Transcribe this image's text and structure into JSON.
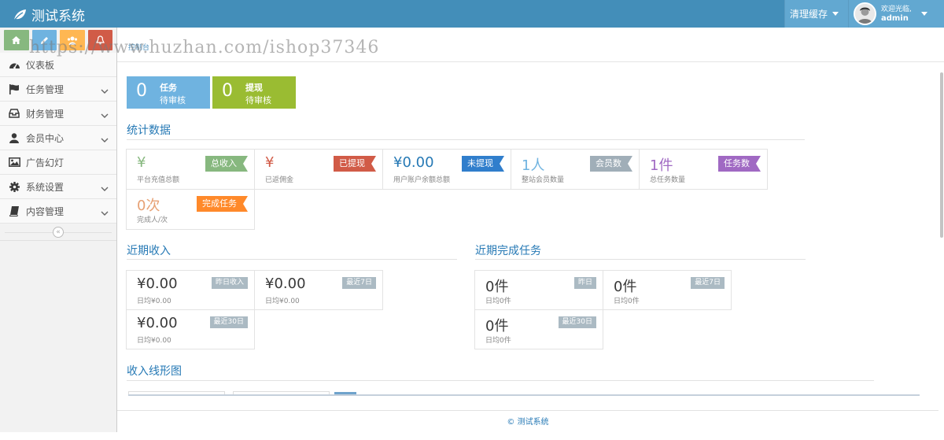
{
  "app": {
    "title": "测试系统"
  },
  "navbar": {
    "clear_cache": "清理缓存",
    "welcome": "欢迎光临,",
    "username": "admin"
  },
  "watermark": "https://www.huzhan.com/ishop37346",
  "breadcrumb": "控制台",
  "sidebar": {
    "items": [
      {
        "label": "仪表板",
        "icon": "dashboard-icon",
        "has_children": false
      },
      {
        "label": "任务管理",
        "icon": "flag-icon",
        "has_children": true
      },
      {
        "label": "财务管理",
        "icon": "inbox-icon",
        "has_children": true
      },
      {
        "label": "会员中心",
        "icon": "user-icon",
        "has_children": true
      },
      {
        "label": "广告幻灯",
        "icon": "picture-icon",
        "has_children": false
      },
      {
        "label": "系统设置",
        "icon": "gear-icon",
        "has_children": true
      },
      {
        "label": "内容管理",
        "icon": "book-icon",
        "has_children": true
      }
    ]
  },
  "pending": [
    {
      "count": "0",
      "title": "任务",
      "subtitle": "待审核",
      "color": "#6fb3e0"
    },
    {
      "count": "0",
      "title": "提现",
      "subtitle": "待审核",
      "color": "#9abc32"
    }
  ],
  "stats": {
    "title": "统计数据",
    "cells": [
      {
        "value": "¥",
        "label": "平台充值总额",
        "tag": "总收入",
        "value_color": "#87b87f",
        "tag_color": "#87b87f"
      },
      {
        "value": "¥",
        "label": "已返佣金",
        "tag": "已提现",
        "value_color": "#d15b47",
        "tag_color": "#d15b47"
      },
      {
        "value": "¥0.00",
        "label": "用户账户余额总额",
        "tag": "未提现",
        "value_color": "#2679b5",
        "tag_color": "#307ecc"
      },
      {
        "value": "1人",
        "label": "整站会员数量",
        "tag": "会员数",
        "value_color": "#6fb3e0",
        "tag_color": "#a0aeb8"
      },
      {
        "value": "1件",
        "label": "总任务数量",
        "tag": "任务数",
        "value_color": "#a069c3",
        "tag_color": "#a069c3"
      },
      {
        "value": "0次",
        "label": "完成人/次",
        "tag": "完成任务",
        "value_color": "#e7a174",
        "tag_color": "#ff892a"
      }
    ]
  },
  "income": {
    "title": "近期收入",
    "cells": [
      {
        "value": "¥0.00",
        "sub": "日均¥0.00",
        "tag": "昨日收入"
      },
      {
        "value": "¥0.00",
        "sub": "日均¥0.00",
        "tag": "最近7日"
      },
      {
        "value": "¥0.00",
        "sub": "日均¥0.00",
        "tag": "最近30日"
      }
    ]
  },
  "tasks": {
    "title": "近期完成任务",
    "cells": [
      {
        "value": "0件",
        "sub": "日均0件",
        "tag": "昨日"
      },
      {
        "value": "0件",
        "sub": "日均0件",
        "tag": "最近7日"
      },
      {
        "value": "0件",
        "sub": "日均0件",
        "tag": "最近30日"
      }
    ]
  },
  "chart_section": {
    "title": "收入线形图"
  },
  "footer": "© 测试系统"
}
